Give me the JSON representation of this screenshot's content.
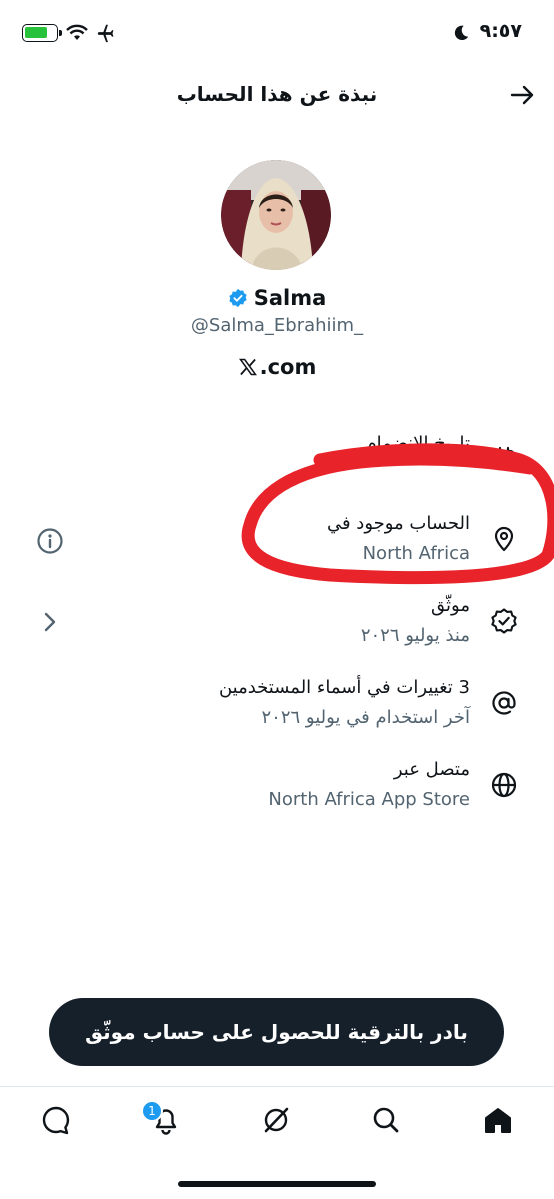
{
  "status_bar": {
    "time": "٩:٥٧"
  },
  "header": {
    "title": "نبذة عن هذا الحساب"
  },
  "profile": {
    "name": "Salma",
    "handle": "@Salma_Ebrahiim_",
    "site": ".com"
  },
  "info_items": [
    {
      "icon": "calendar-icon",
      "title": "تاريخ الانضمام",
      "subtitle": ""
    },
    {
      "icon": "location-pin-icon",
      "title": "الحساب موجود في",
      "subtitle": "North Africa"
    },
    {
      "icon": "verified-badge-icon",
      "title": "موثّق",
      "subtitle": "منذ يوليو ٢٠٢٦"
    },
    {
      "icon": "at-sign-icon",
      "title": "3 تغييرات في أسماء المستخدمين",
      "subtitle": "آخر استخدام في يوليو ٢٠٢٦"
    },
    {
      "icon": "globe-icon",
      "title": "متصل عبر",
      "subtitle": "North Africa App Store"
    }
  ],
  "upgrade_banner": {
    "label": "بادر بالترقية للحصول على حساب موثّق"
  },
  "bottom_nav": {
    "notification_count": "1",
    "items": [
      "chat-icon",
      "bell-icon",
      "grok-icon",
      "search-icon",
      "home-icon"
    ]
  },
  "colors": {
    "accent": "#1d9bf0",
    "annotation": "#e8232a",
    "banner": "#15202b",
    "secondary_text": "#536471"
  }
}
